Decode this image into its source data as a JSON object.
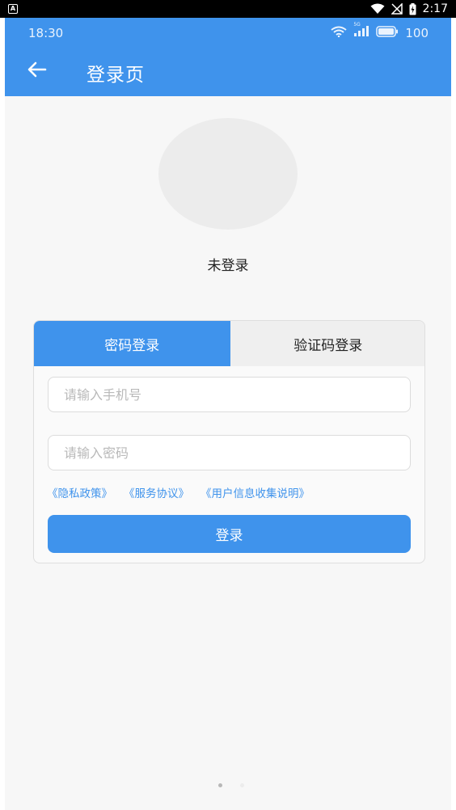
{
  "device_status": {
    "badge": "A",
    "time": "2:17"
  },
  "app_status": {
    "time": "18:30",
    "battery": "100",
    "network": "5G"
  },
  "header": {
    "title": "登录页"
  },
  "profile": {
    "name": "未登录"
  },
  "tabs": [
    {
      "label": "密码登录",
      "active": true
    },
    {
      "label": "验证码登录",
      "active": false
    }
  ],
  "form": {
    "phone_placeholder": "请输入手机号",
    "password_placeholder": "请输入密码"
  },
  "links": [
    "《隐私政策》",
    "《服务协议》",
    "《用户信息收集说明》"
  ],
  "login_button": "登录",
  "colors": {
    "primary": "#3f93ec",
    "background": "#f7f7f7"
  }
}
